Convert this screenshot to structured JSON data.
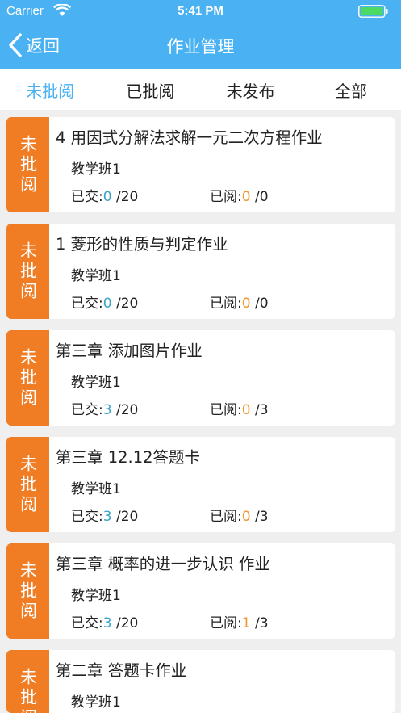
{
  "status_bar": {
    "carrier": "Carrier",
    "time": "5:41 PM"
  },
  "nav": {
    "back_label": "返回",
    "title": "作业管理"
  },
  "tabs": [
    {
      "label": "未批阅",
      "active": true
    },
    {
      "label": "已批阅",
      "active": false
    },
    {
      "label": "未发布",
      "active": false
    },
    {
      "label": "全部",
      "active": false
    }
  ],
  "submitted_label": "已交:",
  "read_label": "已阅:",
  "assignments": [
    {
      "badge": "未批阅",
      "title": "4 用因式分解法求解一元二次方程作业",
      "class": "教学班1",
      "submitted": "0",
      "submitted_total": " /20",
      "read": "0",
      "read_total": " /0"
    },
    {
      "badge": "未批阅",
      "title": "1 菱形的性质与判定作业",
      "class": "教学班1",
      "submitted": "0",
      "submitted_total": " /20",
      "read": "0",
      "read_total": " /0"
    },
    {
      "badge": "未批阅",
      "title": "第三章 添加图片作业",
      "class": "教学班1",
      "submitted": "3",
      "submitted_total": " /20",
      "read": "0",
      "read_total": " /3"
    },
    {
      "badge": "未批阅",
      "title": "第三章 12.12答题卡",
      "class": "教学班1",
      "submitted": "3",
      "submitted_total": " /20",
      "read": "0",
      "read_total": " /3"
    },
    {
      "badge": "未批阅",
      "title": "第三章 概率的进一步认识 作业",
      "class": "教学班1",
      "submitted": "3",
      "submitted_total": " /20",
      "read": "1",
      "read_total": " /3"
    },
    {
      "badge": "未批阅",
      "title": "第二章 答题卡作业",
      "class": "教学班1",
      "submitted": "",
      "submitted_total": "",
      "read": "",
      "read_total": ""
    }
  ]
}
